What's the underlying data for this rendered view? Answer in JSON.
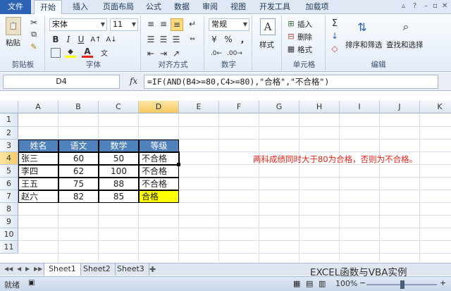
{
  "menu": {
    "file": "文件",
    "tabs": [
      "开始",
      "插入",
      "页面布局",
      "公式",
      "数据",
      "审阅",
      "视图",
      "开发工具",
      "加载项"
    ]
  },
  "ribbon": {
    "clipboard": {
      "label": "剪贴板",
      "paste": "粘贴"
    },
    "font": {
      "label": "字体",
      "name": "宋体",
      "size": "11",
      "bold": "B",
      "italic": "I",
      "underline": "U",
      "font_color": "A"
    },
    "alignment": {
      "label": "对齐方式"
    },
    "number": {
      "label": "数字",
      "format": "常规",
      "percent": "%",
      "comma": ","
    },
    "styles": {
      "label": "样式",
      "letter": "A"
    },
    "cells": {
      "label": "单元格",
      "insert": "插入",
      "delete": "删除",
      "format": "格式"
    },
    "editing": {
      "label": "编辑",
      "sort_filter": "排序和筛选",
      "find_select": "查找和选择"
    }
  },
  "formula_bar": {
    "name_box": "D4",
    "fx": "fx",
    "formula": "=IF(AND(B4>=80,C4>=80),\"合格\",\"不合格\")"
  },
  "grid": {
    "columns": [
      "A",
      "B",
      "C",
      "D",
      "E",
      "F",
      "G",
      "H",
      "I",
      "J",
      "K"
    ],
    "rows": [
      "1",
      "2",
      "3",
      "4",
      "5",
      "6",
      "7",
      "8",
      "9",
      "10",
      "11"
    ],
    "active_cell": "D4",
    "table_header": [
      "姓名",
      "语文",
      "数学",
      "等级"
    ],
    "table_rows": [
      [
        "张三",
        "60",
        "50",
        "不合格"
      ],
      [
        "李四",
        "62",
        "100",
        "不合格"
      ],
      [
        "王五",
        "75",
        "88",
        "不合格"
      ],
      [
        "赵六",
        "82",
        "85",
        "合格"
      ]
    ],
    "note": "两科成绩同时大于80为合格，否则为不合格。",
    "colors": {
      "header_fill": "#4f81bd",
      "pass_fill": "#ffff00",
      "note_color": "#e2231a"
    }
  },
  "sheets": [
    "Sheet1",
    "Sheet2",
    "Sheet3"
  ],
  "active_sheet": "Sheet1",
  "watermark": "EXCEL函数与VBA实例",
  "status": {
    "ready": "就绪",
    "zoom": "100%"
  }
}
